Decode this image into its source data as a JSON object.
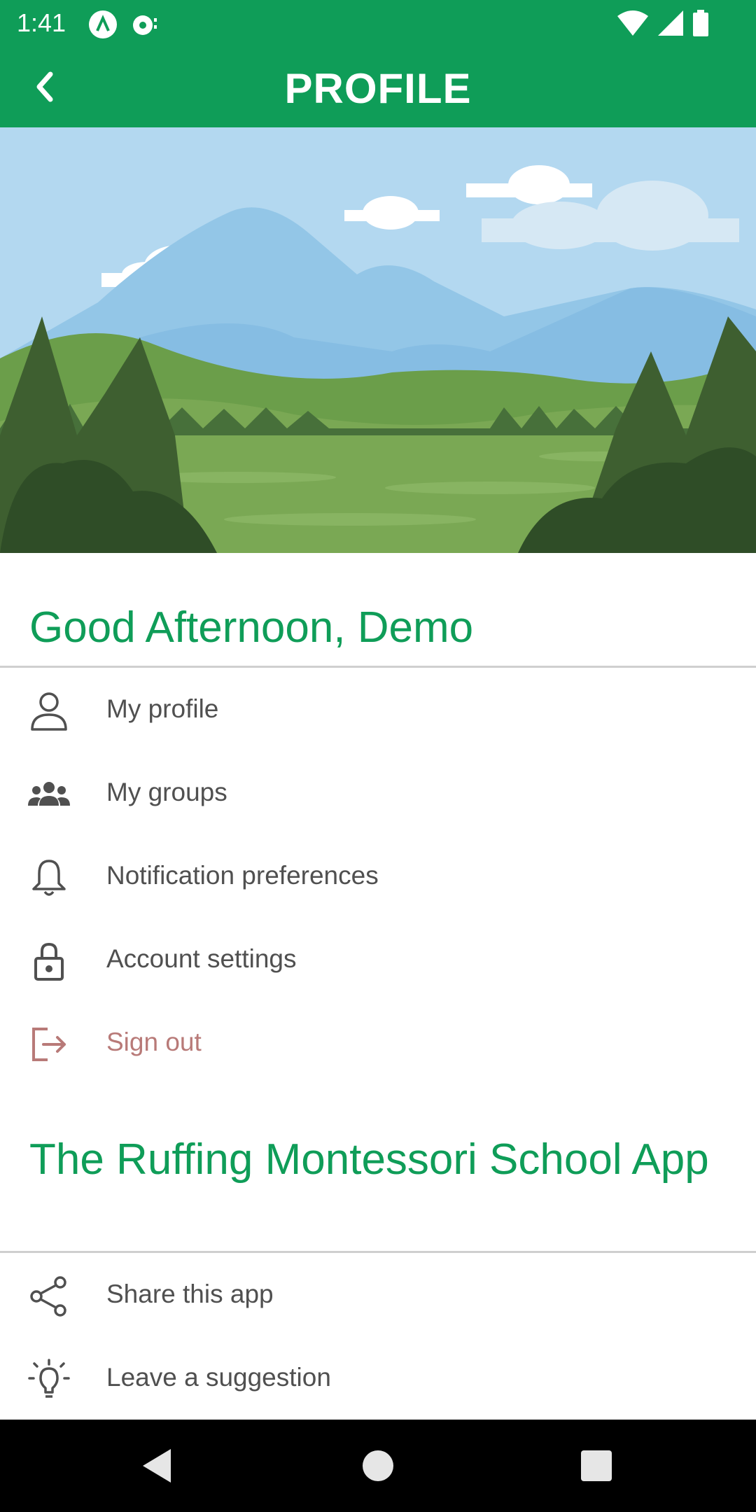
{
  "status_bar": {
    "time": "1:41",
    "left_icons": [
      "app-notification-icon",
      "media-notification-icon"
    ],
    "right_icons": [
      "wifi-icon",
      "cellular-signal-icon",
      "battery-icon"
    ]
  },
  "app_bar": {
    "title": "PROFILE",
    "back_icon": "back-arrow-icon"
  },
  "colors": {
    "brand_green": "#0f9d58",
    "text_gray": "#505050",
    "danger": "#b87a78"
  },
  "greeting_section": {
    "title": "Good Afternoon, Demo",
    "items": [
      {
        "label": "My profile",
        "icon": "person-icon"
      },
      {
        "label": "My groups",
        "icon": "groups-icon"
      },
      {
        "label": "Notification preferences",
        "icon": "bell-icon"
      },
      {
        "label": "Account settings",
        "icon": "lock-icon"
      },
      {
        "label": "Sign out",
        "icon": "sign-out-icon"
      }
    ]
  },
  "app_section": {
    "title": "The Ruffing Montessori School App",
    "items": [
      {
        "label": "Share this app",
        "icon": "share-icon"
      },
      {
        "label": "Leave a suggestion",
        "icon": "lightbulb-icon"
      }
    ]
  },
  "nav_bar": {
    "buttons": [
      "back-triangle-icon",
      "home-circle-icon",
      "recents-square-icon"
    ]
  }
}
